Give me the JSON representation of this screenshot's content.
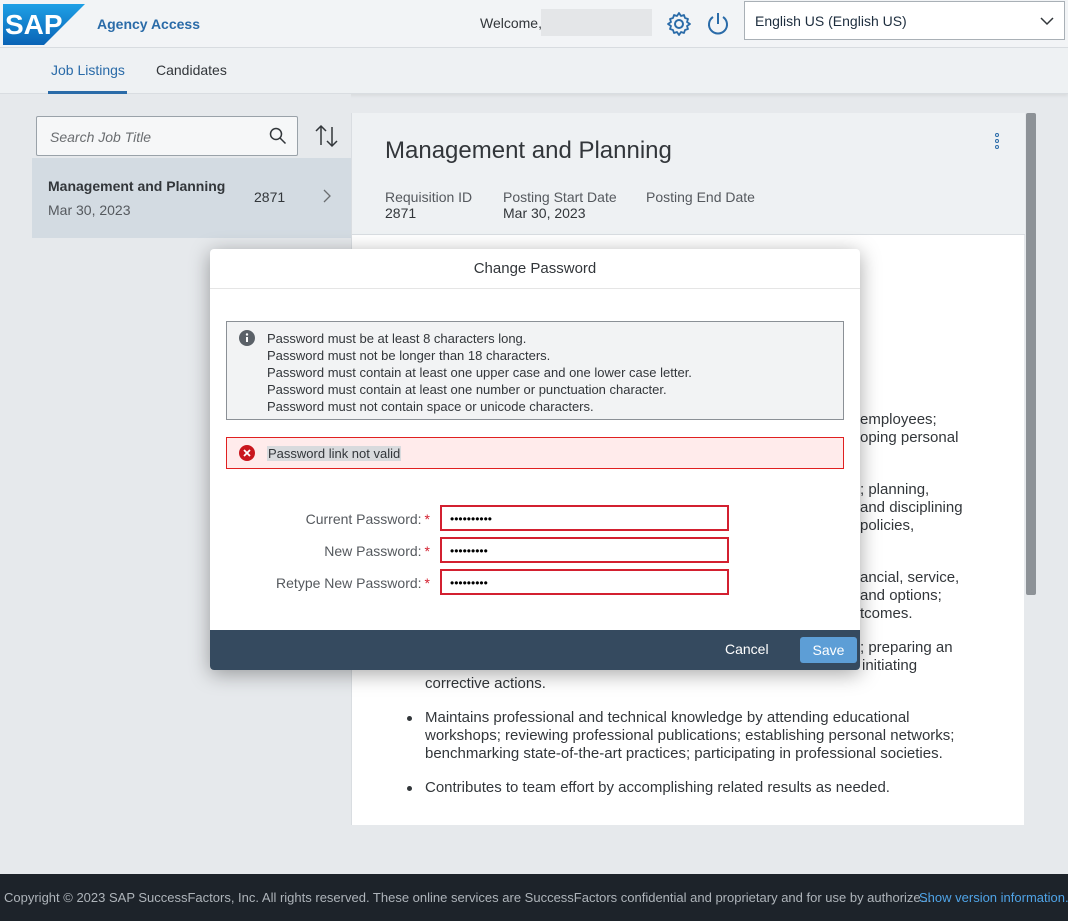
{
  "header": {
    "logo_text": "SAP",
    "app_title": "Agency Access",
    "welcome": "Welcome,",
    "language": "English US (English US)"
  },
  "tabs": [
    {
      "label": "Job Listings",
      "active": true
    },
    {
      "label": "Candidates",
      "active": false
    }
  ],
  "search": {
    "placeholder": "Search Job Title"
  },
  "list": [
    {
      "title": "Management and Planning",
      "date": "Mar 30, 2023",
      "id": "2871"
    }
  ],
  "detail": {
    "title": "Management and Planning",
    "fields": [
      {
        "label": "Requisition ID",
        "value": "2871"
      },
      {
        "label": "Posting Start Date",
        "value": "Mar 30, 2023"
      },
      {
        "label": "Posting End Date",
        "value": ""
      }
    ],
    "visible_fragments": [
      "employees;",
      "oping personal",
      "; planning,",
      "and disciplining",
      "policies,",
      "ancial, service,",
      "and options;",
      "tcomes.",
      "; preparing an",
      "initiating"
    ],
    "bullets": [
      {
        "lines": [
          "corrective actions."
        ]
      },
      {
        "lines": [
          "Maintains professional and technical knowledge by attending educational",
          "workshops; reviewing professional publications; establishing personal networks;",
          "benchmarking state-of-the-art practices; participating in professional societies."
        ]
      },
      {
        "lines": [
          "Contributes to team effort by accomplishing related results as needed."
        ]
      }
    ]
  },
  "dialog": {
    "title": "Change Password",
    "rules": [
      "Password must be at least 8 characters long.",
      "Password must not be longer than 18 characters.",
      "Password must contain at least one upper case and one lower case letter.",
      "Password must contain at least one number or punctuation character.",
      "Password must not contain space or unicode characters."
    ],
    "error": "Password link not valid",
    "fields": [
      {
        "label": "Current Password:",
        "value": "••••••••••"
      },
      {
        "label": "New Password:",
        "value": "•••••••••"
      },
      {
        "label": "Retype New Password:",
        "value": "•••••••••"
      }
    ],
    "cancel": "Cancel",
    "save": "Save"
  },
  "footer": {
    "copyright": "Copyright © 2023 SAP SuccessFactors, Inc. All rights reserved. These online services are SuccessFactors confidential and proprietary and for use by authorize...",
    "version_link": "Show version information."
  },
  "colors": {
    "brand": "#2a6ba8",
    "error": "#d32030",
    "dialog_footer": "#354a5f",
    "save": "#5d9ed6"
  }
}
